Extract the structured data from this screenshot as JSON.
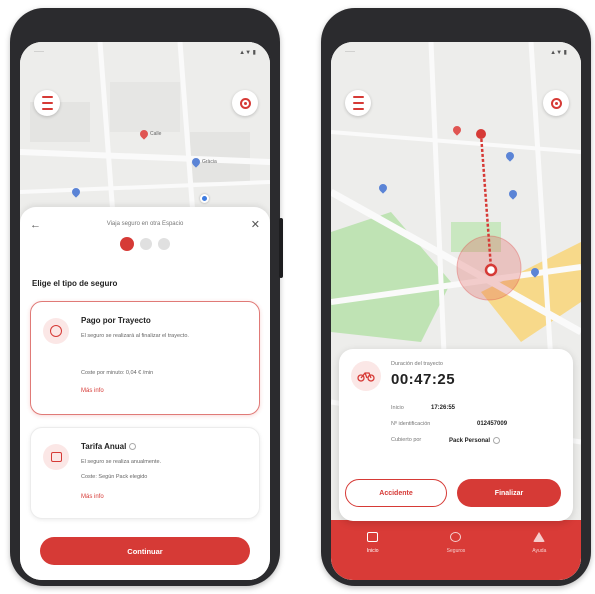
{
  "left_screen": {
    "sheet_header": "Viaja seguro en otra Espacio",
    "section_title": "Elige el tipo de seguro",
    "options": [
      {
        "title": "Pago por Trayecto",
        "description": "El seguro se realizará al finalizar el trayecto.",
        "cost": "Coste por minuto: 0,04 € /min",
        "more": "Más info"
      },
      {
        "title": "Tarifa Anual",
        "description": "El seguro se realiza anualmente.",
        "cost": "Coste: Según Pack elegido",
        "more": "Más info"
      }
    ],
    "cta_label": "Continuar",
    "map_labels": [
      "Calle",
      "Gràcia"
    ]
  },
  "right_screen": {
    "duration_label": "Duración del trayecto",
    "duration_value": "00:47:25",
    "rows": [
      {
        "label": "Inicio",
        "value": "17:26:55"
      },
      {
        "label": "Nº identificación",
        "value": "012457009"
      },
      {
        "label": "Cubierto por",
        "value": "Pack Personal"
      }
    ],
    "accident_label": "Accidente",
    "finish_label": "Finalizar",
    "tabs": [
      {
        "label": "Inicio"
      },
      {
        "label": "Seguros"
      },
      {
        "label": "Ayuda"
      }
    ]
  },
  "colors": {
    "accent": "#d63a36",
    "tabbar": "#d93b37"
  }
}
